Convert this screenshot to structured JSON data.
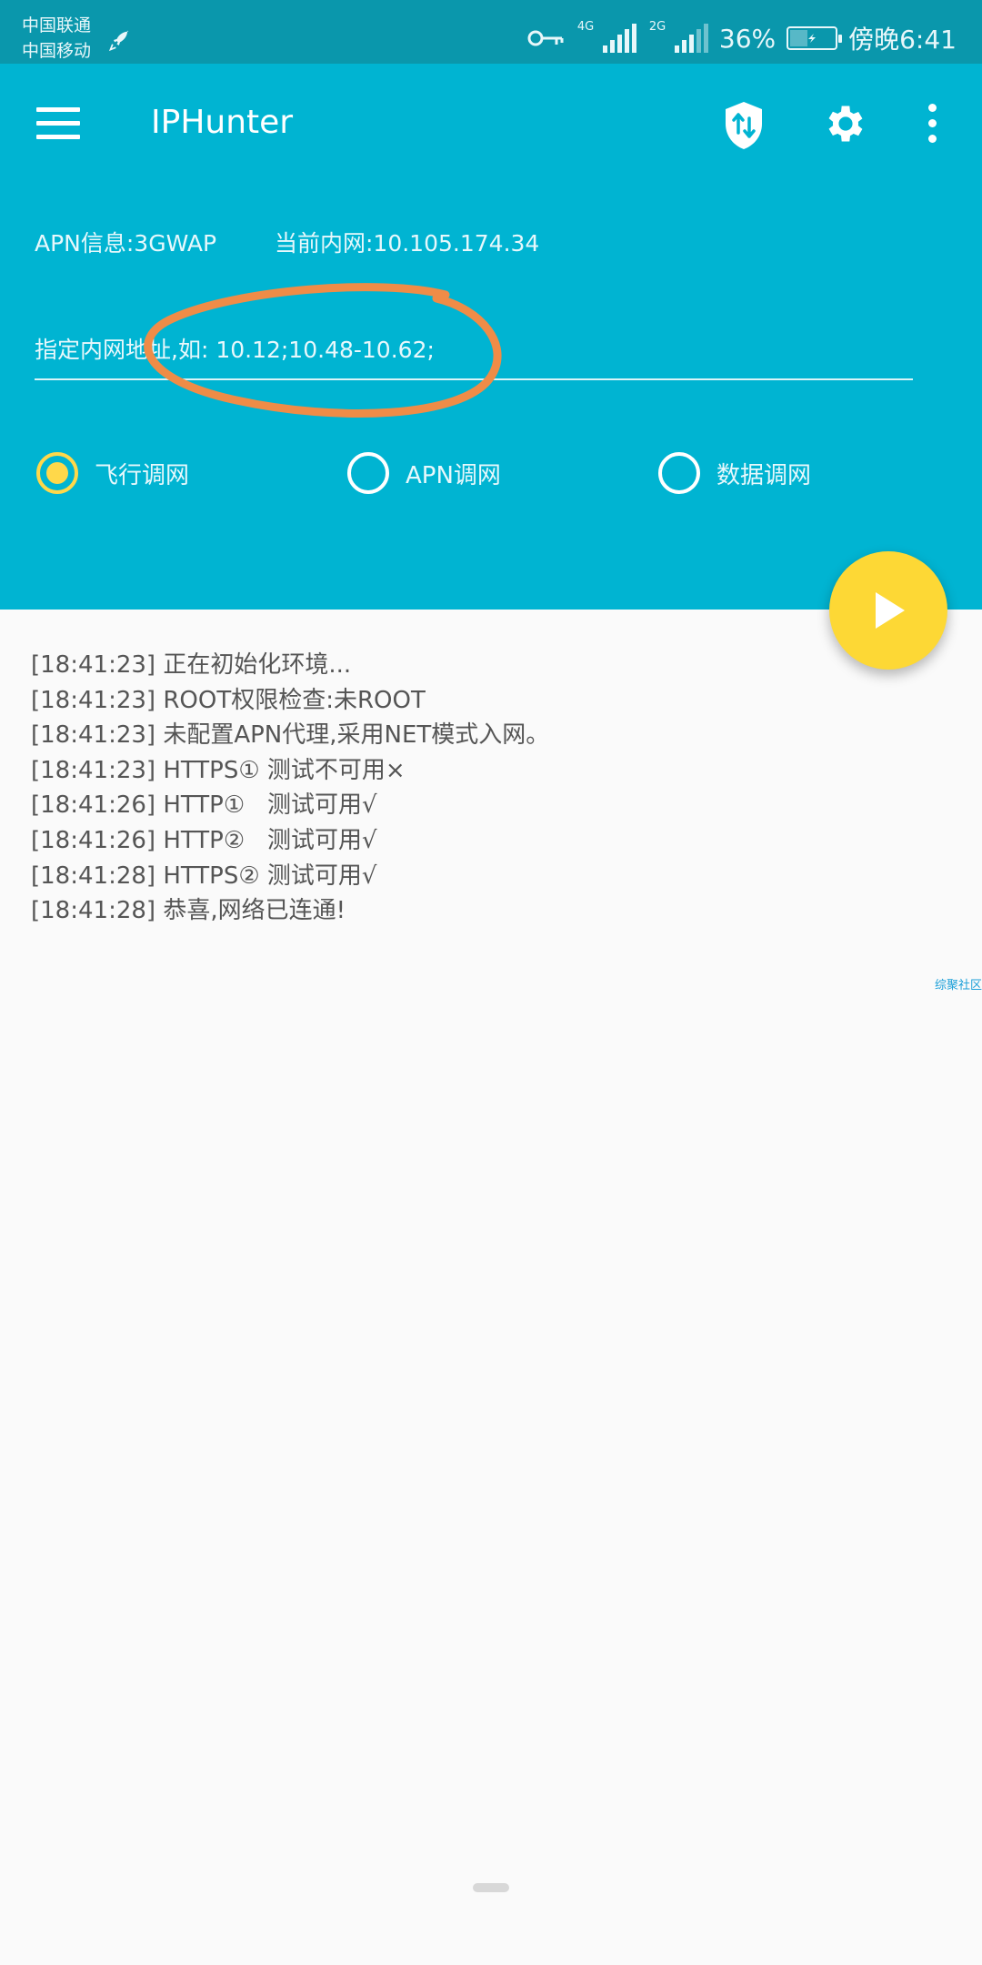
{
  "status_bar": {
    "carrier_1": "中国联通",
    "carrier_2": "中国移动",
    "net_type_1": "4G",
    "net_type_2": "2G",
    "battery": "36%",
    "time": "傍晚6:41",
    "icons": [
      "rocket-icon",
      "key-icon",
      "signal-icon",
      "battery-icon"
    ]
  },
  "toolbar": {
    "title": "IPHunter",
    "icons": [
      "menu-icon",
      "shield-swap-icon",
      "gear-icon",
      "more-icon"
    ]
  },
  "info": {
    "apn": "APN信息:3GWAP",
    "inner_ip": "当前内网:10.105.174.34"
  },
  "ip_input": {
    "placeholder": "指定内网地址,如: 10.12;10.48-10.62;",
    "value": ""
  },
  "modes": [
    {
      "label": "飞行调网",
      "checked": true
    },
    {
      "label": "APN调网",
      "checked": false
    },
    {
      "label": "数据调网",
      "checked": false
    }
  ],
  "log": [
    "[18:41:23] 正在初始化环境...",
    "[18:41:23] ROOT权限检查:未ROOT",
    "[18:41:23] 未配置APN代理,采用NET模式入网。",
    "[18:41:23] HTTPS① 测试不可用×",
    "[18:41:26] HTTP①   测试可用√",
    "[18:41:26] HTTP②   测试可用√",
    "[18:41:28] HTTPS② 测试可用√",
    "[18:41:28] 恭喜,网络已连通!"
  ],
  "watermark": "综聚社区",
  "colors": {
    "header": "#00b4d2",
    "status_bar": "#0a97ac",
    "fab": "#fdd835",
    "annotation": "#ef8c47"
  }
}
